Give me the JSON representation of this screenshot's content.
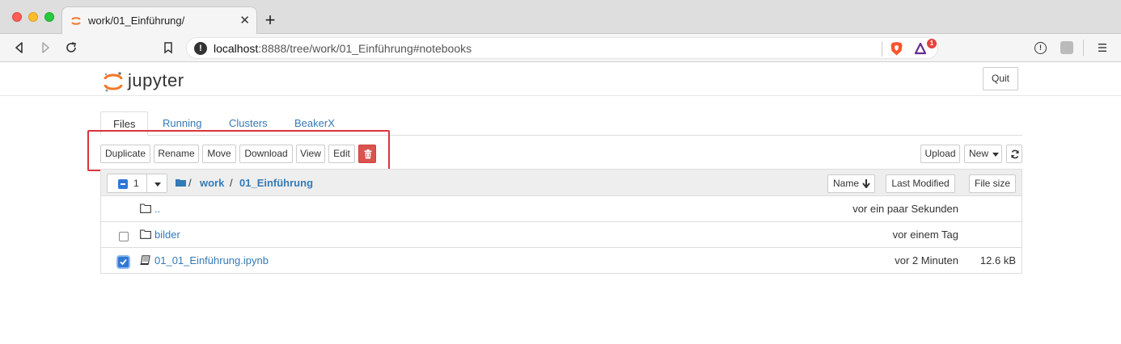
{
  "browser": {
    "tab_title": "work/01_Einführung/",
    "url_host": "localhost",
    "url_rest": ":8888/tree/work/01_Einführung#notebooks",
    "notification_count": "1"
  },
  "header": {
    "logo_text": "jupyter",
    "quit_label": "Quit"
  },
  "tabs": [
    {
      "label": "Files"
    },
    {
      "label": "Running"
    },
    {
      "label": "Clusters"
    },
    {
      "label": "BeakerX"
    }
  ],
  "actions": {
    "duplicate": "Duplicate",
    "rename": "Rename",
    "move": "Move",
    "download": "Download",
    "view": "View",
    "edit": "Edit",
    "upload": "Upload",
    "new": "New"
  },
  "list_header": {
    "selected_count": "1",
    "breadcrumb_sep": "/",
    "crumb_work": "work",
    "crumb_current": "01_Einführung",
    "name_label": "Name",
    "last_modified_label": "Last Modified",
    "file_size_label": "File size"
  },
  "items": [
    {
      "name": "..",
      "modified": "vor ein paar Sekunden",
      "size": "",
      "checked": false
    },
    {
      "name": "bilder",
      "modified": "vor einem Tag",
      "size": "",
      "checked": false
    },
    {
      "name": "01_01_Einführung.ipynb",
      "modified": "vor 2 Minuten",
      "size": "12.6 kB",
      "checked": true
    }
  ],
  "colors": {
    "accent": "#337ab7",
    "danger": "#d9534f",
    "highlight_box": "#d9343c",
    "checkbox_checked": "#2f78d5"
  }
}
